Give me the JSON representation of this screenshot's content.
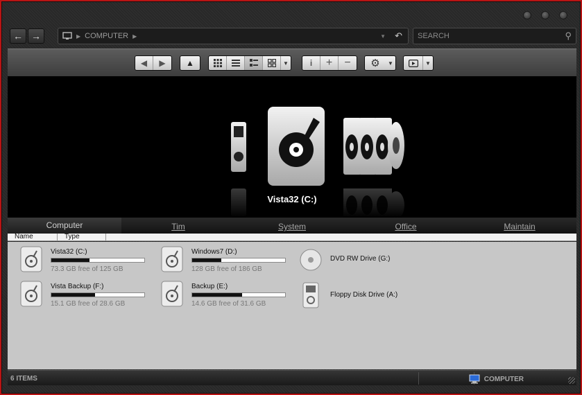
{
  "window": {
    "buttons": [
      "minimize",
      "maximize",
      "close"
    ]
  },
  "address_bar": {
    "location": "COMPUTER",
    "icon": "computer-icon"
  },
  "search": {
    "placeholder": "SEARCH"
  },
  "stage": {
    "selected_label": "Vista32 (C:)"
  },
  "tabs": [
    {
      "label": "Computer",
      "active": true
    },
    {
      "label": "Tim",
      "active": false
    },
    {
      "label": "System",
      "active": false
    },
    {
      "label": "Office",
      "active": false
    },
    {
      "label": "Maintain",
      "active": false
    }
  ],
  "columns": {
    "name": "Name",
    "type": "Type"
  },
  "drives": [
    {
      "name": "Vista32 (C:)",
      "free_text": "73.3 GB free of 125 GB",
      "used_fraction": 0.41,
      "icon": "hard-drive-icon"
    },
    {
      "name": "Windows7 (D:)",
      "free_text": "128 GB free of 186 GB",
      "used_fraction": 0.31,
      "icon": "hard-drive-icon"
    },
    {
      "name": "DVD RW Drive (G:)",
      "icon": "optical-drive-icon"
    },
    {
      "name": "Vista Backup (F:)",
      "free_text": "15.1 GB free of 28.6 GB",
      "used_fraction": 0.47,
      "icon": "hard-drive-icon"
    },
    {
      "name": "Backup (E:)",
      "free_text": "14.6 GB free of 31.6 GB",
      "used_fraction": 0.54,
      "icon": "hard-drive-icon"
    },
    {
      "name": "Floppy Disk Drive (A:)",
      "icon": "floppy-drive-icon"
    }
  ],
  "status": {
    "count": "6 ITEMS",
    "location": "COMPUTER"
  },
  "colors": {
    "frame_border": "#b81414",
    "pane_bg": "#c7c7c7",
    "stage_bg": "#000000"
  }
}
